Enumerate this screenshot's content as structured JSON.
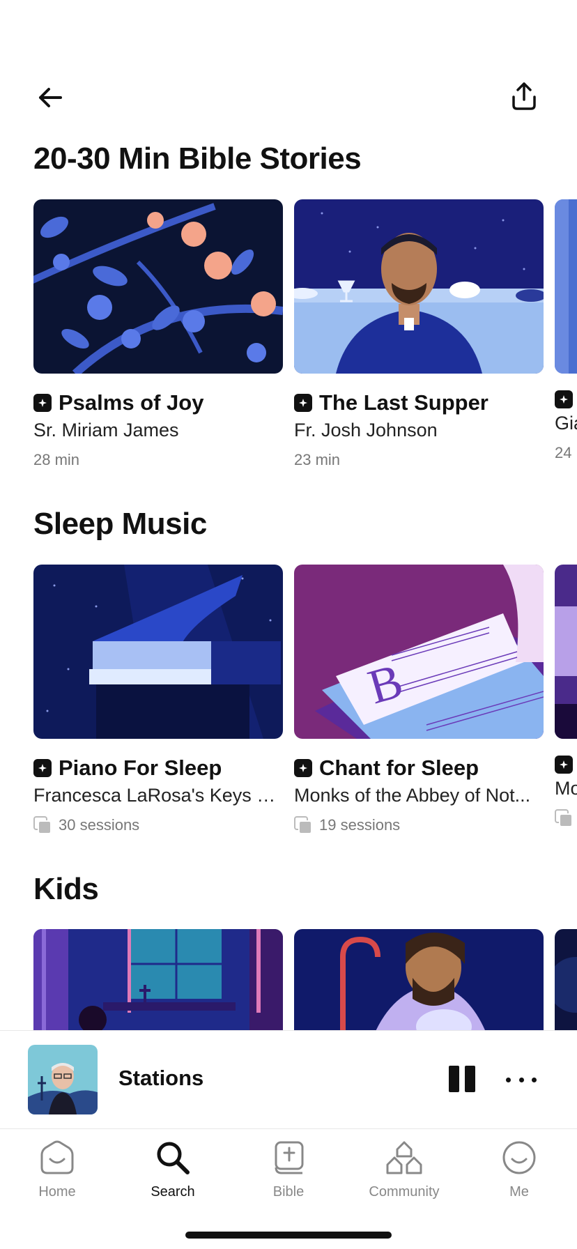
{
  "header": {
    "back_icon": "arrow-left-icon",
    "share_icon": "share-upload-icon"
  },
  "sections": [
    {
      "title": "20-30 Min Bible Stories",
      "cards": [
        {
          "title": "Psalms of Joy",
          "author": "Sr. Miriam James",
          "meta": "28 min",
          "badge_icon": "plus-badge-icon"
        },
        {
          "title": "The Last Supper",
          "author": "Fr. Josh Johnson",
          "meta": "23 min",
          "badge_icon": "plus-badge-icon"
        },
        {
          "title": "",
          "author": "Gia",
          "meta": "24",
          "badge_icon": "plus-badge-icon"
        }
      ]
    },
    {
      "title": "Sleep Music",
      "cards": [
        {
          "title": "Piano For Sleep",
          "author": "Francesca LaRosa's Keys of...",
          "meta": "30 sessions",
          "badge_icon": "plus-badge-icon",
          "meta_icon": "sessions-icon"
        },
        {
          "title": "Chant for Sleep",
          "author": "Monks of the Abbey of Not...",
          "meta": "19 sessions",
          "badge_icon": "plus-badge-icon",
          "meta_icon": "sessions-icon"
        },
        {
          "title": "",
          "author": "Mo",
          "meta": "",
          "badge_icon": "plus-badge-icon",
          "meta_icon": "sessions-icon"
        }
      ]
    },
    {
      "title": "Kids",
      "cards": [
        {
          "title": "",
          "author": "",
          "meta": ""
        },
        {
          "title": "",
          "author": "",
          "meta": ""
        },
        {
          "title": "",
          "author": "",
          "meta": ""
        }
      ]
    }
  ],
  "mini_player": {
    "title": "Stations",
    "pause_icon": "pause-icon",
    "more_icon": "more-dots-icon"
  },
  "tabbar": {
    "items": [
      {
        "label": "Home",
        "icon": "home-icon",
        "active": false
      },
      {
        "label": "Search",
        "icon": "search-icon",
        "active": true
      },
      {
        "label": "Bible",
        "icon": "bible-icon",
        "active": false
      },
      {
        "label": "Community",
        "icon": "community-icon",
        "active": false
      },
      {
        "label": "Me",
        "icon": "smiley-icon",
        "active": false
      }
    ]
  },
  "colors": {
    "accent": "#111111",
    "muted": "#888888",
    "art_navy": "#0d1b4a",
    "art_blue": "#3a55c8",
    "art_purple": "#7a2a7a"
  }
}
